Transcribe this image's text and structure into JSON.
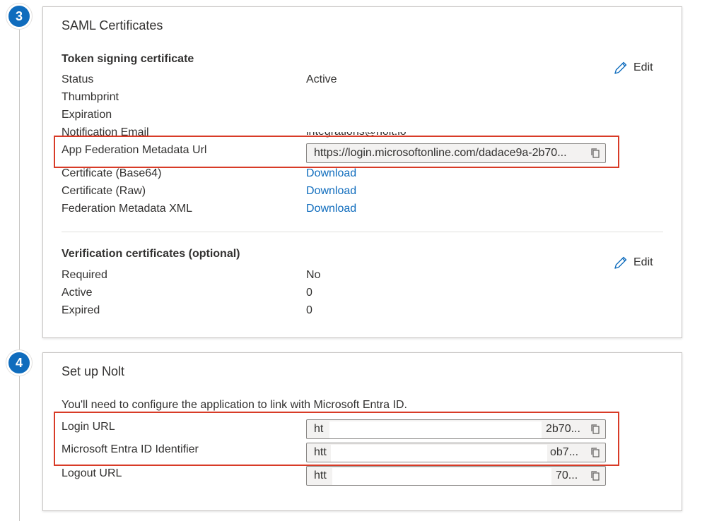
{
  "steps": [
    {
      "number": "3",
      "title": "SAML Certificates",
      "token_signing": {
        "heading": "Token signing certificate",
        "edit_label": "Edit",
        "rows": {
          "status": {
            "label": "Status",
            "value": "Active"
          },
          "thumbprint": {
            "label": "Thumbprint"
          },
          "expiration": {
            "label": "Expiration"
          },
          "notification": {
            "label": "Notification Email",
            "value": "integrations@nolt.io"
          },
          "metadata_url": {
            "label": "App Federation Metadata Url",
            "value": "https://login.microsoftonline.com/dadace9a-2b70..."
          },
          "cert_base64": {
            "label": "Certificate (Base64)",
            "value": "Download"
          },
          "cert_raw": {
            "label": "Certificate (Raw)",
            "value": "Download"
          },
          "fed_xml": {
            "label": "Federation Metadata XML",
            "value": "Download"
          }
        }
      },
      "verification": {
        "heading": "Verification certificates (optional)",
        "edit_label": "Edit",
        "rows": {
          "required": {
            "label": "Required",
            "value": "No"
          },
          "active": {
            "label": "Active",
            "value": "0"
          },
          "expired": {
            "label": "Expired",
            "value": "0"
          }
        }
      }
    },
    {
      "number": "4",
      "title": "Set up Nolt",
      "description": "You'll need to configure the application to link with Microsoft Entra ID.",
      "fields": {
        "login_url": {
          "label": "Login URL",
          "prefix": "ht",
          "suffix": "2b70..."
        },
        "entra_id": {
          "label": "Microsoft Entra ID Identifier",
          "prefix": "htt",
          "suffix": "ob7..."
        },
        "logout_url": {
          "label": "Logout URL",
          "prefix": "htt",
          "suffix": "70..."
        }
      }
    }
  ],
  "icons": {
    "edit": "pencil-icon",
    "copy": "copy-icon"
  },
  "colors": {
    "accent": "#0f6cbd",
    "highlight": "#d83b27",
    "field_bg": "#f3f2f1"
  }
}
